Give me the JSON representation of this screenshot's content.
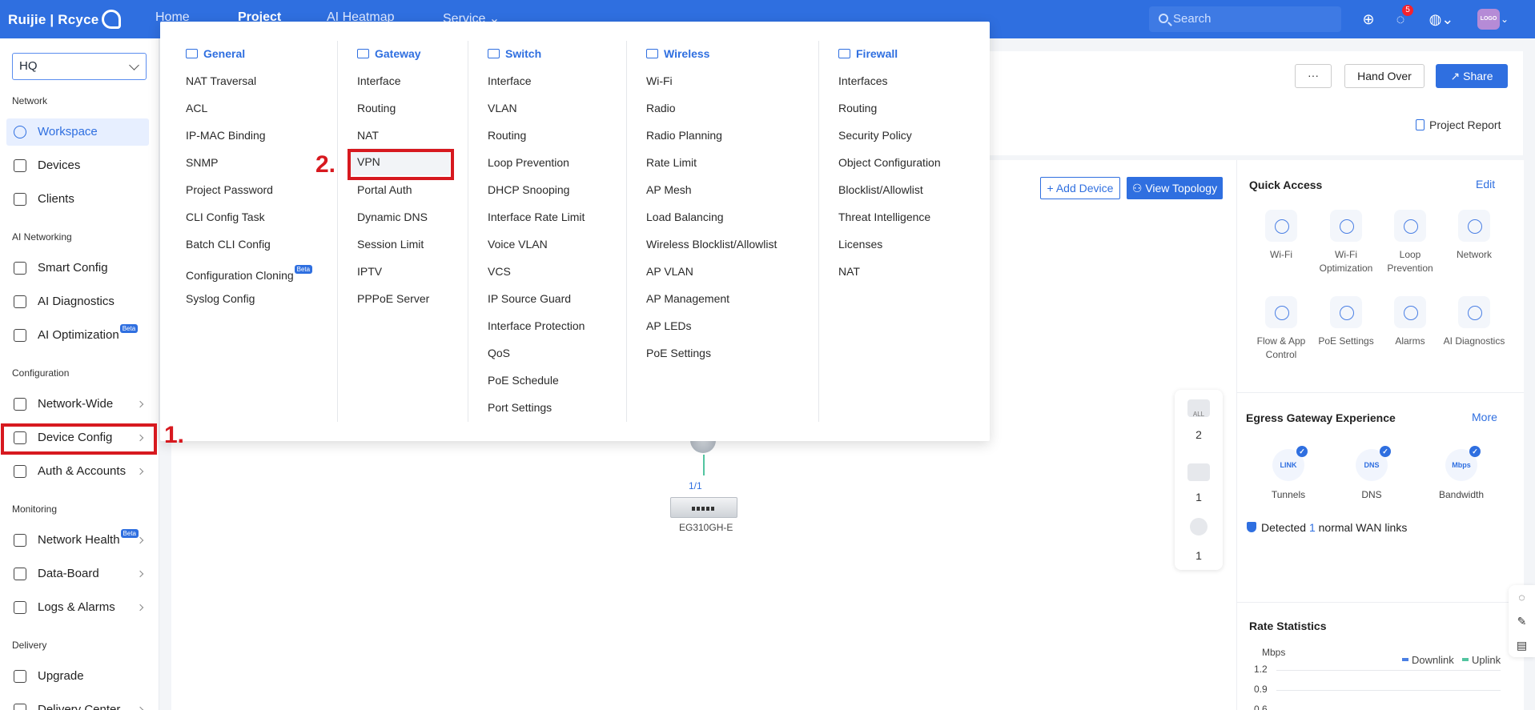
{
  "topbar": {
    "brand": "Ruijie | Rcyce",
    "nav": [
      "Home",
      "Project",
      "AI Heatmap",
      "Service"
    ],
    "search_placeholder": "Search",
    "notification_count": "5",
    "avatar_text": "LOGO"
  },
  "sidebar": {
    "site": "HQ",
    "sections": {
      "network": "Network",
      "ai_networking": "AI Networking",
      "configuration": "Configuration",
      "monitoring": "Monitoring",
      "delivery": "Delivery"
    },
    "items": {
      "workspace": "Workspace",
      "devices": "Devices",
      "clients": "Clients",
      "smart_config": "Smart Config",
      "ai_diagnostics": "AI Diagnostics",
      "ai_optimization": "AI Optimization",
      "network_wide": "Network-Wide",
      "device_config": "Device Config",
      "auth_accounts": "Auth & Accounts",
      "network_health": "Network Health",
      "data_board": "Data-Board",
      "logs_alarms": "Logs & Alarms",
      "upgrade": "Upgrade",
      "delivery_center": "Delivery Center"
    },
    "beta_label": "Beta"
  },
  "header": {
    "more_label": "···",
    "hand_over_label": "Hand Over",
    "share_label": "Share",
    "project_report_label": "Project Report"
  },
  "topology": {
    "add_device_label": "Add Device",
    "view_topology_label": "View Topology",
    "port_label": "1/1",
    "gateway_name": "EG310GH-E",
    "filter": {
      "all_label": "ALL",
      "all_count": "2",
      "gateway_count": "1",
      "camera_count": "1"
    }
  },
  "dropdown": {
    "general": {
      "title": "General",
      "items": [
        "NAT Traversal",
        "ACL",
        "IP-MAC Binding",
        "SNMP",
        "Project Password",
        "CLI Config Task",
        "Batch CLI Config",
        "Configuration Cloning",
        "Syslog Config"
      ]
    },
    "gateway": {
      "title": "Gateway",
      "items": [
        "Interface",
        "Routing",
        "NAT",
        "VPN",
        "Portal Auth",
        "Dynamic DNS",
        "Session Limit",
        "IPTV",
        "PPPoE Server"
      ]
    },
    "switch": {
      "title": "Switch",
      "items": [
        "Interface",
        "VLAN",
        "Routing",
        "Loop Prevention",
        "DHCP Snooping",
        "Interface Rate Limit",
        "Voice VLAN",
        "VCS",
        "IP Source Guard",
        "Interface Protection",
        "QoS",
        "PoE Schedule",
        "Port Settings"
      ]
    },
    "wireless": {
      "title": "Wireless",
      "items": [
        "Wi-Fi",
        "Radio",
        "Radio Planning",
        "Rate Limit",
        "AP Mesh",
        "Load Balancing",
        "Wireless Blocklist/Allowlist",
        "AP VLAN",
        "AP Management",
        "AP LEDs",
        "PoE Settings"
      ]
    },
    "firewall": {
      "title": "Firewall",
      "items": [
        "Interfaces",
        "Routing",
        "Security Policy",
        "Object Configuration",
        "Blocklist/Allowlist",
        "Threat Intelligence",
        "Licenses",
        "NAT"
      ]
    }
  },
  "quick_access": {
    "title": "Quick Access",
    "edit_label": "Edit",
    "items": [
      "Wi-Fi",
      "Wi-Fi Optimization",
      "Loop Prevention",
      "Network",
      "Flow & App Control",
      "PoE Settings",
      "Alarms",
      "AI Diagnostics"
    ]
  },
  "egress": {
    "title": "Egress Gateway Experience",
    "more_label": "More",
    "items": [
      "Tunnels",
      "DNS",
      "Bandwidth"
    ],
    "icon_texts": [
      "LINK",
      "DNS",
      "Mbps"
    ],
    "detected_prefix": "Detected",
    "detected_count": "1",
    "detected_suffix": "normal WAN links"
  },
  "rate_stats": {
    "title": "Rate Statistics",
    "unit": "Mbps",
    "ticks": [
      "1.2",
      "0.9",
      "0.6"
    ],
    "legend": [
      "Downlink",
      "Uplink"
    ]
  },
  "annotations": {
    "step1": "1.",
    "step2": "2."
  },
  "colors": {
    "brand_blue": "#2f6fe0",
    "annotation_red": "#d7191f",
    "downlink": "#4a7fe4",
    "uplink": "#52c4a0"
  }
}
